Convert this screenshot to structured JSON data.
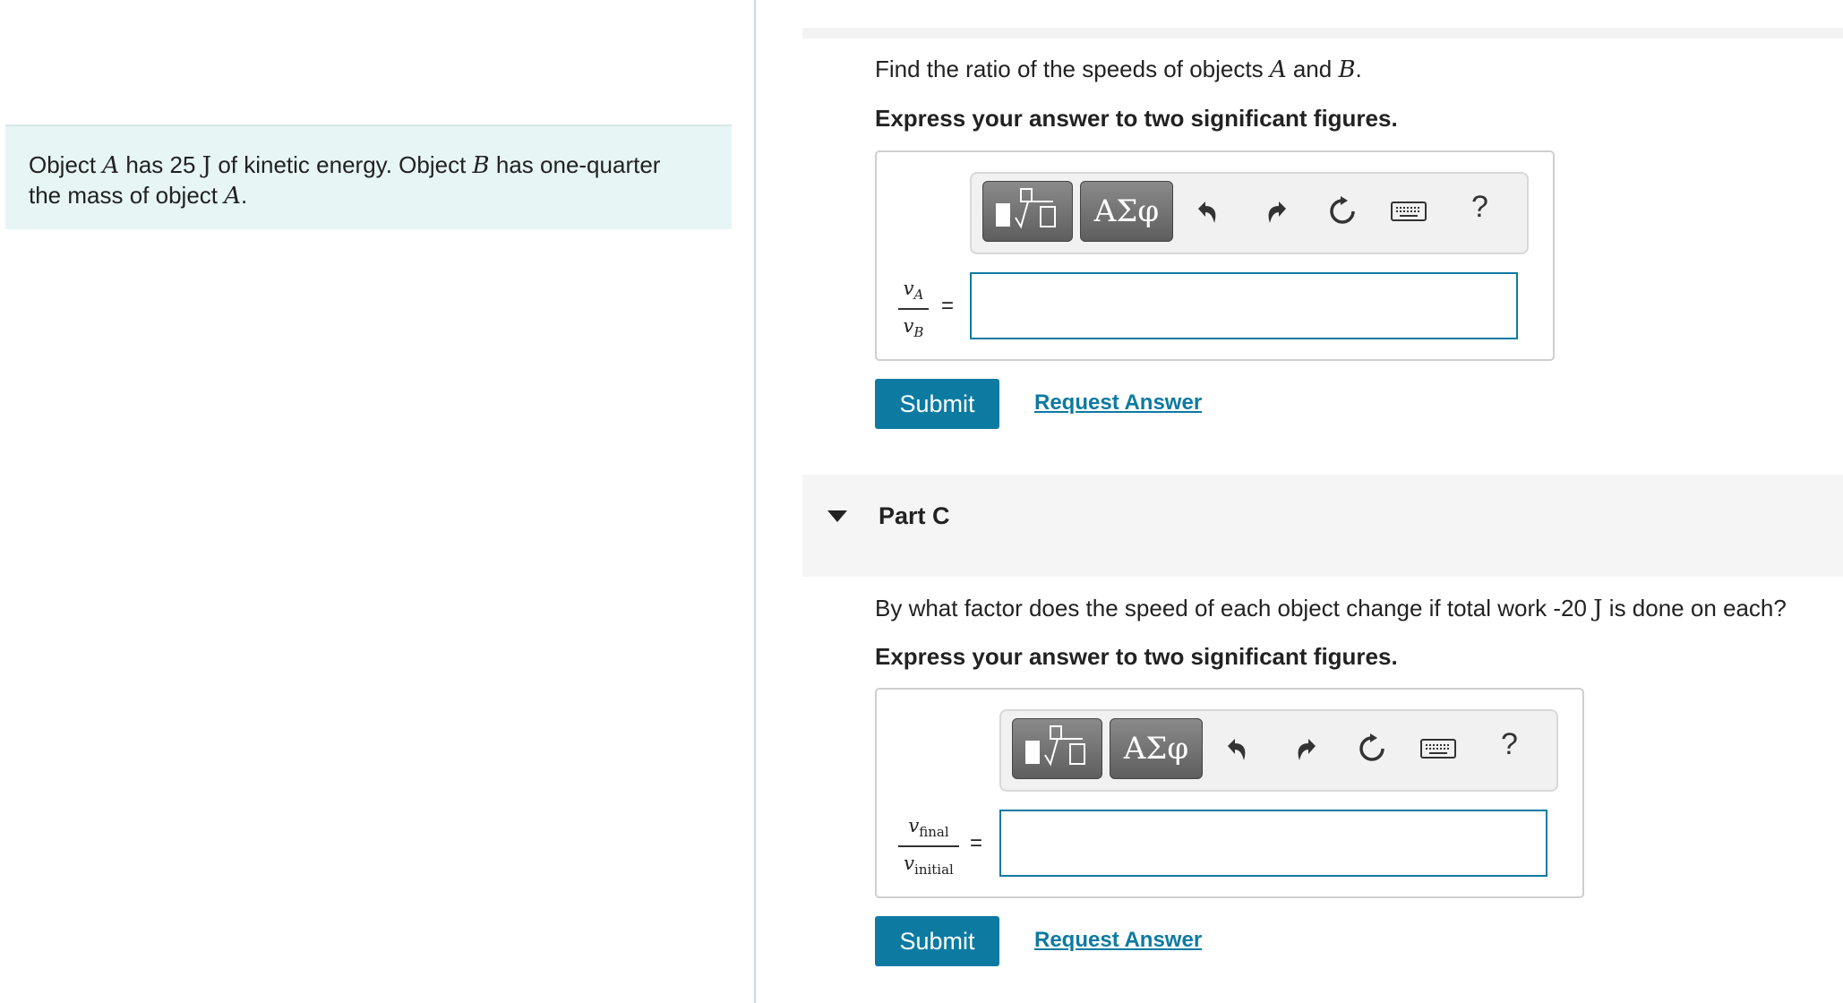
{
  "intro": {
    "line1_a": "Object ",
    "obj_a": "A",
    "line1_b": " has 25 ",
    "unit_j": "J",
    "line1_c": " of kinetic energy. Object ",
    "obj_b": "B",
    "line1_d": " has one-quarter",
    "line2_a": "the mass of object ",
    "obj_a2": "A",
    "line2_b": "."
  },
  "part_b": {
    "prompt_a": "Find the ratio of the speeds of objects ",
    "obj_a": "A",
    "prompt_b": " and ",
    "obj_b": "B",
    "prompt_c": ".",
    "instruction": "Express your answer to two significant figures.",
    "frac_num": "v",
    "frac_num_sub": "A",
    "frac_den": "v",
    "frac_den_sub": "B",
    "equals": "=",
    "answer_value": "",
    "submit_label": "Submit",
    "request_label": "Request Answer"
  },
  "part_c": {
    "title": "Part C",
    "prompt_a": "By what factor does the speed of each object change if total work -20 ",
    "unit_j": "J",
    "prompt_b": " is done on each?",
    "instruction": "Express your answer to two significant figures.",
    "frac_num": "v",
    "frac_num_sub": "final",
    "frac_den": "v",
    "frac_den_sub": "initial",
    "equals": "=",
    "answer_value": "",
    "submit_label": "Submit",
    "request_label": "Request Answer"
  },
  "toolbar": {
    "greek_label": "ΑΣφ",
    "help_label": "?",
    "icons": [
      "templates-icon",
      "greek-symbols-icon",
      "undo-icon",
      "redo-icon",
      "reset-icon",
      "keyboard-icon",
      "help-icon"
    ]
  },
  "colors": {
    "accent": "#0d7aa2",
    "intro_bg": "#e7f5f5",
    "part_header_bg": "#f5f5f5"
  }
}
